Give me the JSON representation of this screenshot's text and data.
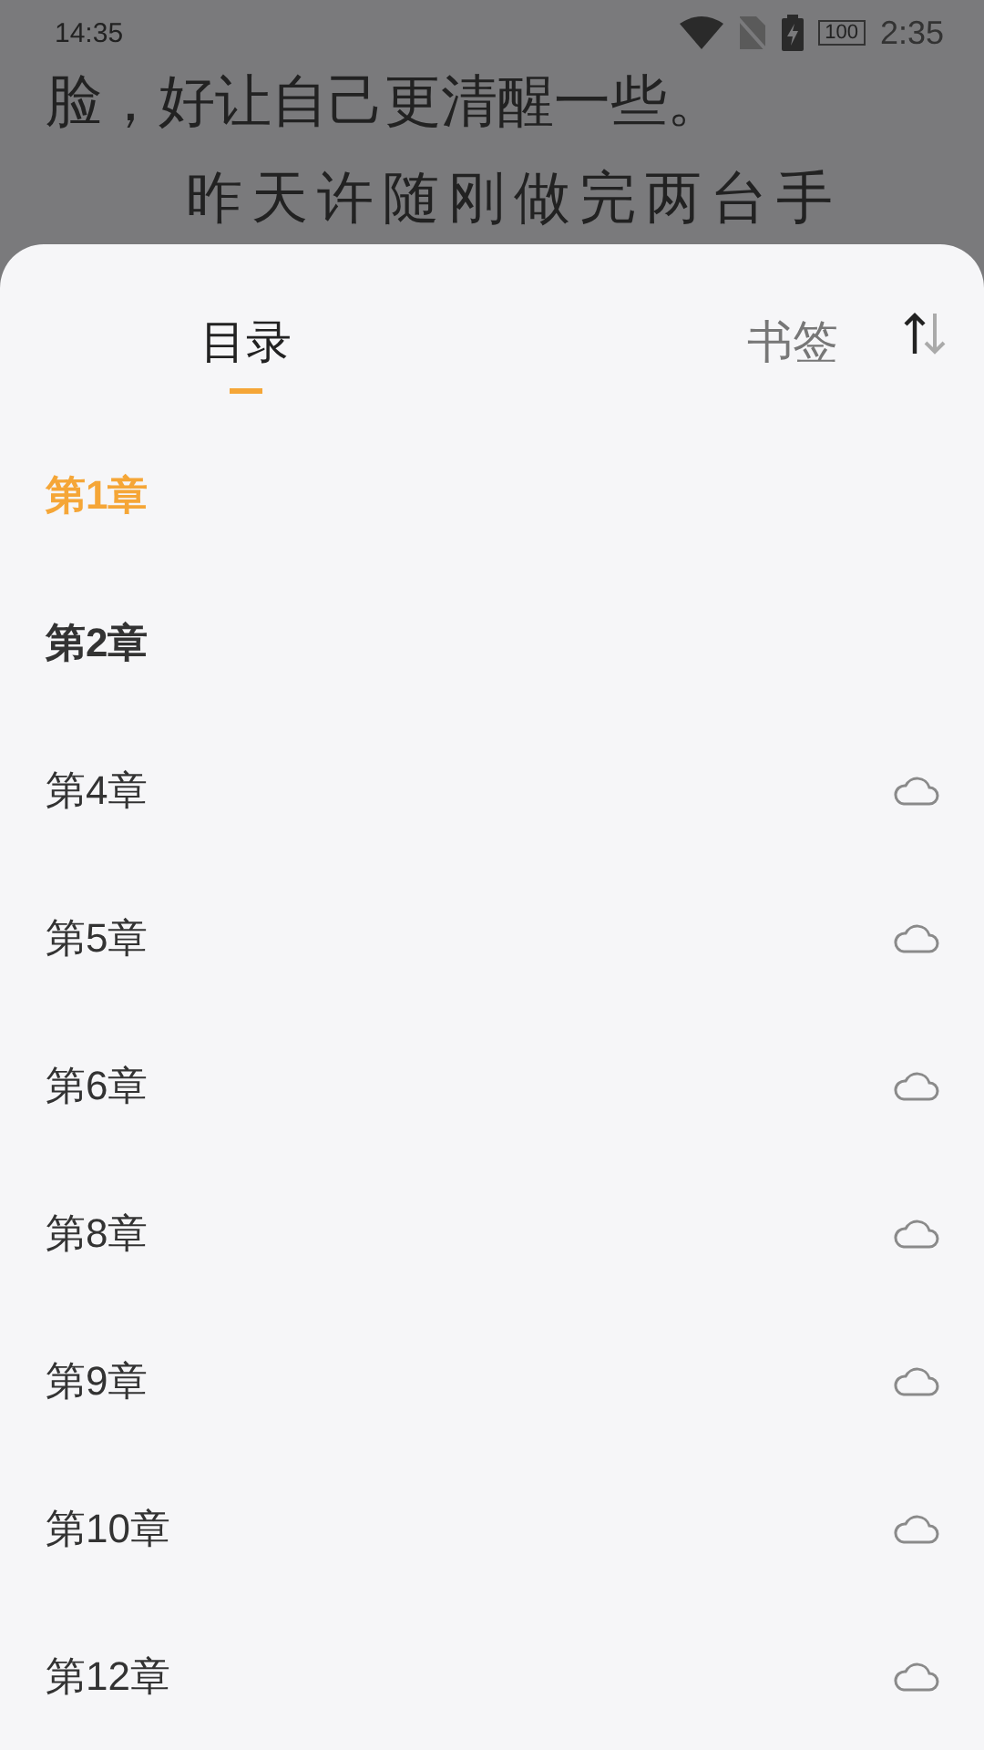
{
  "status_bar": {
    "time": "14:35",
    "battery": "100",
    "clock_echo": "2:35"
  },
  "reader_text": [
    "脸，好让自己更清醒一些。",
    "昨天许随刚做完两台手"
  ],
  "tabs": [
    {
      "label": "目录",
      "selected": true
    },
    {
      "label": "书签",
      "selected": false
    }
  ],
  "chapters": [
    {
      "title": "第1章",
      "current": true,
      "downloaded": true
    },
    {
      "title": "第2章",
      "current": false,
      "downloaded": true
    },
    {
      "title": "第4章",
      "current": false,
      "downloaded": false
    },
    {
      "title": "第5章",
      "current": false,
      "downloaded": false
    },
    {
      "title": "第6章",
      "current": false,
      "downloaded": false
    },
    {
      "title": "第8章",
      "current": false,
      "downloaded": false
    },
    {
      "title": "第9章",
      "current": false,
      "downloaded": false
    },
    {
      "title": "第10章",
      "current": false,
      "downloaded": false
    },
    {
      "title": "第12章",
      "current": false,
      "downloaded": false
    }
  ]
}
